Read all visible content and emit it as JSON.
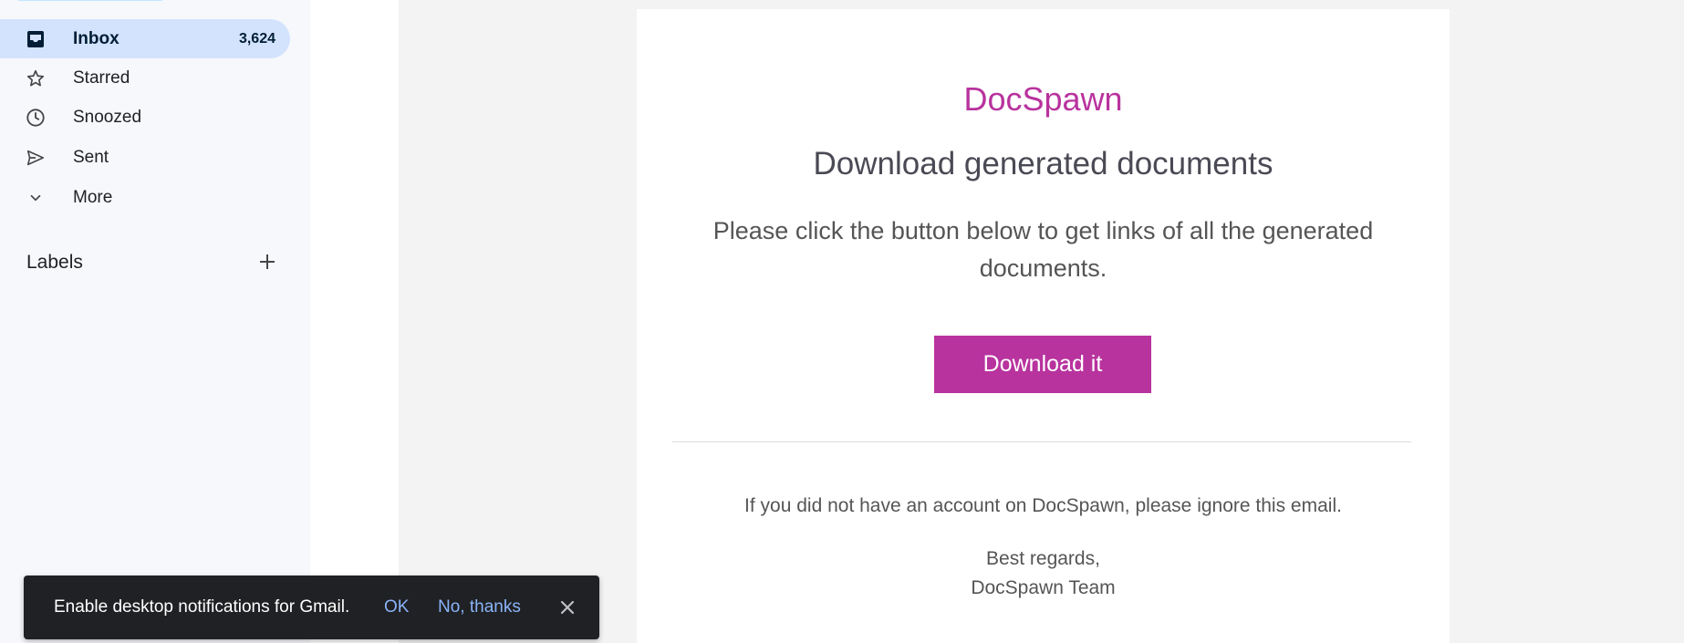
{
  "sidebar": {
    "items": [
      {
        "label": "Inbox",
        "count": "3,624",
        "icon": "inbox-icon",
        "active": true
      },
      {
        "label": "Starred",
        "icon": "star-icon"
      },
      {
        "label": "Snoozed",
        "icon": "clock-icon"
      },
      {
        "label": "Sent",
        "icon": "send-icon"
      },
      {
        "label": "More",
        "icon": "chevron-down-icon"
      }
    ],
    "labels_heading": "Labels"
  },
  "email": {
    "brand": "DocSpawn",
    "headline": "Download generated documents",
    "body": "Please click the button below to get links of all the generated documents.",
    "button_label": "Download it",
    "footer_note": "If you did not have an account on DocSpawn, please ignore this email.",
    "regards_line1": "Best regards,",
    "regards_line2": "DocSpawn Team"
  },
  "snackbar": {
    "message": "Enable desktop notifications for Gmail.",
    "ok_label": "OK",
    "no_label": "No, thanks"
  },
  "colors": {
    "brand": "#b8339e",
    "active_nav": "#d3e3fd",
    "snackbar_link": "#8ab4f8"
  }
}
